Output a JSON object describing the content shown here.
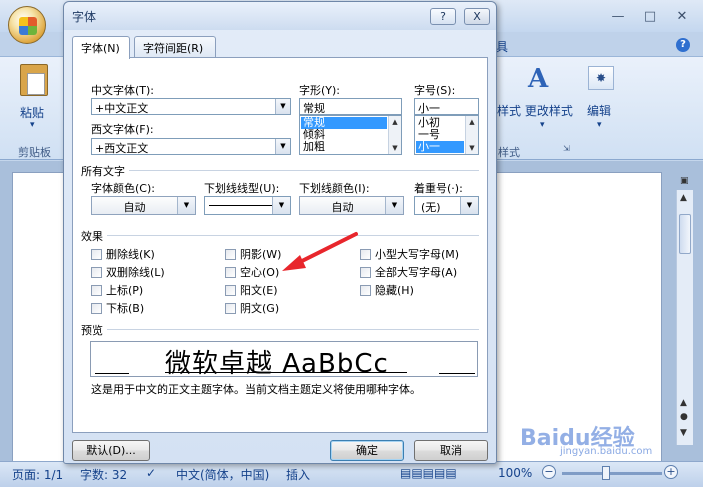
{
  "word": {
    "ribbon_tab_right": "具",
    "paste_label": "粘贴",
    "clipboard_group": "剪贴板",
    "styles_group": "样式",
    "change_styles_label": "样式 更改样式",
    "edit_label": "编辑",
    "edit_icon_glyph": "✸",
    "status": {
      "page": "页面: 1/1",
      "words": "字数: 32",
      "language": "中文(简体，中国)",
      "insert_mode": "插入",
      "zoom": "100%"
    },
    "watermark": "Baidu经验",
    "watermark_sub": "jingyan.baidu.com"
  },
  "dialog": {
    "title": "字体",
    "help_label": "?",
    "close_label": "X",
    "tabs": [
      {
        "label": "字体(N)"
      },
      {
        "label": "字符间距(R)"
      }
    ],
    "font": {
      "chinese_label": "中文字体(T):",
      "chinese_value": "+中文正文",
      "western_label": "西文字体(F):",
      "western_value": "+西文正文",
      "style_label": "字形(Y):",
      "style_value": "常规",
      "style_options": [
        "常规",
        "倾斜",
        "加粗"
      ],
      "size_label": "字号(S):",
      "size_value": "小一",
      "size_options": [
        "小初",
        "一号",
        "小一"
      ]
    },
    "all_text": {
      "section_label": "所有文字",
      "color_label": "字体颜色(C):",
      "color_value": "自动",
      "underline_style_label": "下划线线型(U):",
      "underline_color_label": "下划线颜色(I):",
      "underline_color_value": "自动",
      "emphasis_label": "着重号(·):",
      "emphasis_value": "(无)"
    },
    "effects": {
      "section_label": "效果",
      "col1": [
        "删除线(K)",
        "双删除线(L)",
        "上标(P)",
        "下标(B)"
      ],
      "col2": [
        "阴影(W)",
        "空心(O)",
        "阳文(E)",
        "阴文(G)"
      ],
      "col3": [
        "小型大写字母(M)",
        "全部大写字母(A)",
        "隐藏(H)"
      ]
    },
    "preview": {
      "section_label": "预览",
      "sample": "微软卓越 AaBbCc",
      "description": "这是用于中文的正文主题字体。当前文档主题定义将使用哪种字体。"
    },
    "buttons": {
      "default_label": "默认(D)...",
      "ok_label": "确定",
      "cancel_label": "取消"
    }
  },
  "colors": {
    "accent": "#3399ff",
    "arrow": "#e8262c",
    "ribbon_text": "#15428b"
  }
}
